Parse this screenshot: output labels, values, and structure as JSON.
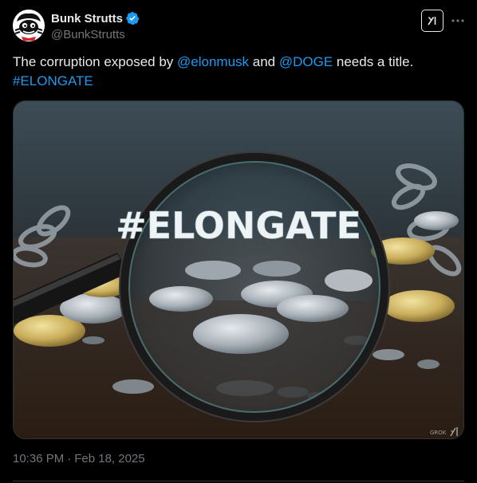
{
  "author": {
    "display_name": "Bunk Strutts",
    "handle": "@BunkStrutts",
    "verified": true,
    "verified_color": "#1d9bf0",
    "avatar_icon": "cartoon-spy-avatar"
  },
  "actions": {
    "grok_icon": "grok-icon",
    "more_icon": "more-dots-icon"
  },
  "tweet": {
    "text_before": "The corruption exposed by ",
    "mention_1": "@elonmusk",
    "text_middle": " and ",
    "mention_2": "@DOGE",
    "text_after": " needs a title.",
    "hashtag": "#ELONGATE"
  },
  "media": {
    "image_text": "#ELONGATE",
    "watermark": "GROK"
  },
  "meta": {
    "time": "10:36 PM",
    "separator": "·",
    "date": "Feb 18, 2025"
  },
  "colors": {
    "background": "#000000",
    "text_primary": "#e7e9ea",
    "text_secondary": "#71767b",
    "link": "#1d9bf0",
    "border": "#2f3336"
  }
}
